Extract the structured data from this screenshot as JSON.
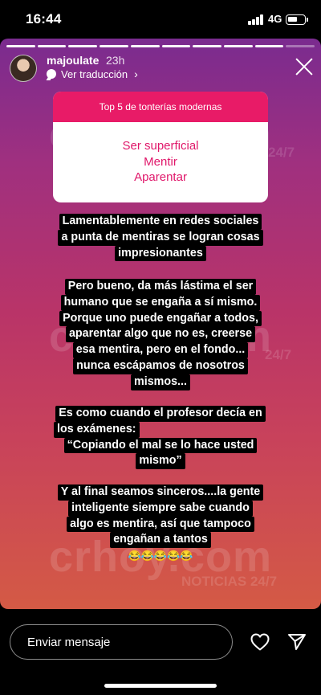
{
  "status_bar": {
    "time": "16:44",
    "network": "4G",
    "battery_level": 0.5
  },
  "story": {
    "progress_segments": 10,
    "progress_done": 9,
    "username": "majoulate",
    "time_ago": "23h",
    "translate_label": "Ver traducción",
    "colors": {
      "gradient_top": "#7a2b8f",
      "gradient_bottom": "#d45a45",
      "sticker_accent": "#e81b67"
    }
  },
  "watermark": {
    "brand": "crhoy.com",
    "tagline_top": "24/7",
    "tagline_bottom": "NOTICIAS 24/7"
  },
  "sticker": {
    "title": "Top 5 de tonterías  modernas",
    "answers": [
      "Ser superficial",
      "Mentir",
      "Aparentar"
    ]
  },
  "paragraphs": [
    [
      "Lamentablemente en redes sociales",
      "a punta de mentiras se logran cosas",
      "impresionantes"
    ],
    [
      "Pero bueno, da más lástima el ser",
      "humano que se engaña a sí mismo.",
      "Porque uno puede engañar a todos,",
      "aparentar algo que no es, creerse",
      "esa mentira, pero en el fondo...",
      "nunca escápamos de nosotros",
      "mismos..."
    ],
    [
      "Es como cuando el profesor decía en",
      "los exámenes:",
      "“Copiando el mal se lo hace usted",
      "mismo”"
    ],
    [
      "Y al final seamos sinceros....la gente",
      "inteligente siempre sabe cuando",
      "algo es mentira, así que tampoco",
      "engañan a tantos",
      "😂😂😂😂😂"
    ]
  ],
  "bottom_bar": {
    "message_placeholder": "Enviar mensaje",
    "like_icon": "heart-icon",
    "send_icon": "send-icon"
  }
}
